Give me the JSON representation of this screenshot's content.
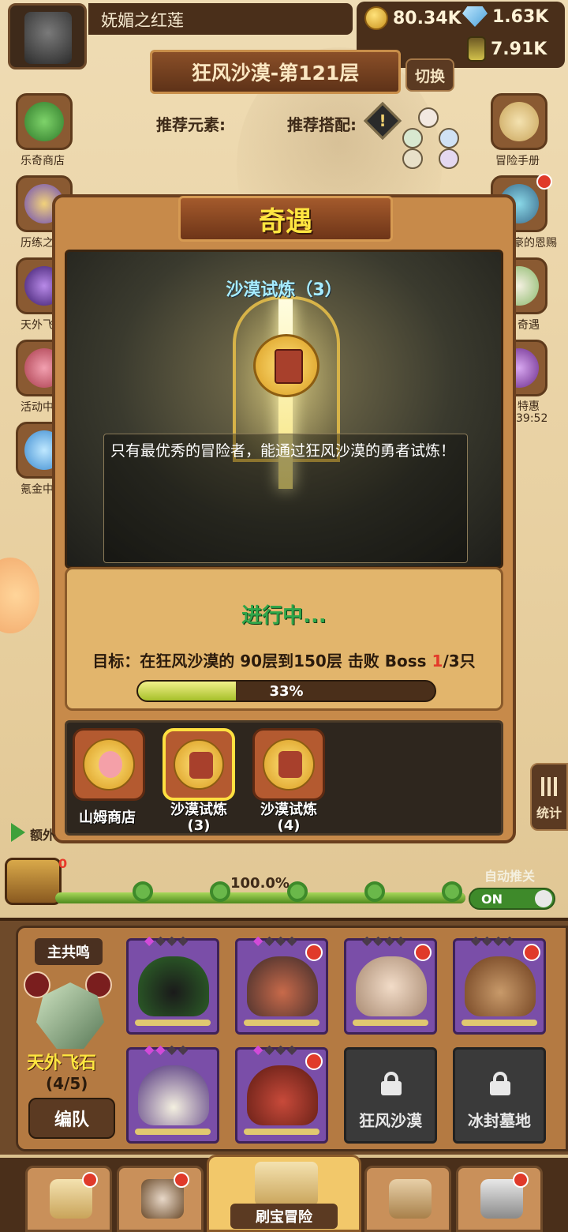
{
  "player": {
    "name": "妩媚之红莲"
  },
  "resources": {
    "gold": "80.34K",
    "gems": "1.63K",
    "potion": "7.91K"
  },
  "stage": {
    "title": "狂风沙漠-第121层",
    "switch_label": "切换"
  },
  "recommend": {
    "element_label": "推荐元素:",
    "combo_label": "推荐搭配:"
  },
  "side_menu": [
    {
      "label": "乐奇商店"
    },
    {
      "label": "历练之"
    },
    {
      "label": "天外飞"
    },
    {
      "label": "活动中"
    },
    {
      "label": "氪金中"
    }
  ],
  "right_menu": [
    {
      "label": "冒险手册"
    },
    {
      "label": "豪的恩赐"
    },
    {
      "label": "奇遇"
    },
    {
      "label": "特惠"
    },
    {
      "label": "39:52"
    }
  ],
  "modal": {
    "title": "奇遇",
    "event_title": "沙漠试炼（3）",
    "description": "只有最优秀的冒险者，能通过狂风沙漠的勇者试炼！",
    "status": "进行中...",
    "goal_prefix": "目标：在狂风沙漠的 90层到150层 击败 Boss ",
    "goal_current": "1",
    "goal_suffix": "/3只",
    "progress": {
      "value": 0.33,
      "label": "33%"
    },
    "options": [
      {
        "label": "山姆商店",
        "selected": false
      },
      {
        "label": "沙漠试炼\n(3)",
        "selected": true
      },
      {
        "label": "沙漠试炼\n(4)",
        "selected": false
      }
    ]
  },
  "stats_button": {
    "label": "统计"
  },
  "extra_label": "额外",
  "track": {
    "chest_count": "0",
    "percent_label": "100.0%",
    "progress": 1.0,
    "auto_label": "自动推关",
    "toggle_label": "ON"
  },
  "team": {
    "chorus_label": "主共鸣",
    "crystal_name": "天外飞石",
    "crystal_count": "(4/5)",
    "formation_button": "编队",
    "locked_slots": [
      "狂风沙漠",
      "冰封墓地"
    ]
  },
  "bottom_nav": {
    "active_label": "刷宝冒险"
  },
  "colors": {
    "accent_gold": "#ffe640",
    "status_green": "#2fa64a",
    "highlight_red": "#e33a2a",
    "panel_brown": "#c78a4a"
  }
}
